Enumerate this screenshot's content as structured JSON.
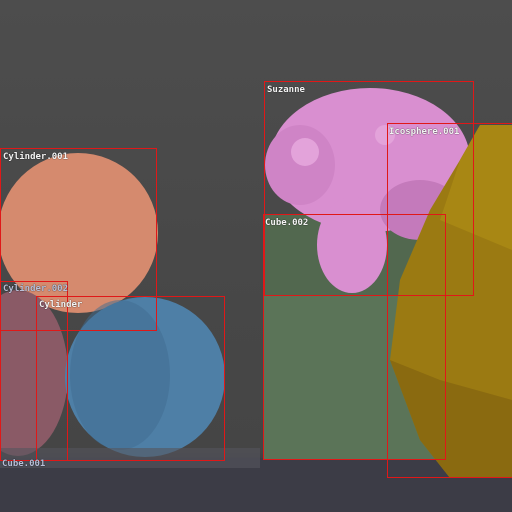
{
  "viewport": {
    "background_color": "#4a4a4a",
    "floor_color": "#3a3a44"
  },
  "objects": [
    {
      "label": "Suzanne",
      "color": "#d98fd0"
    },
    {
      "label": "Icosphere.001",
      "color": "#9b7a12"
    },
    {
      "label": "Cylinder.001",
      "color": "#d58a6e"
    },
    {
      "label": "Cube.002",
      "color": "#5b7458"
    },
    {
      "label": "Cylinder.002",
      "color": "#8a5a66"
    },
    {
      "label": "Cylinder",
      "color": "#4e7fa6"
    },
    {
      "label": "Cube.001",
      "color": "#6b6b70"
    }
  ],
  "bbox_color": "#e01818"
}
